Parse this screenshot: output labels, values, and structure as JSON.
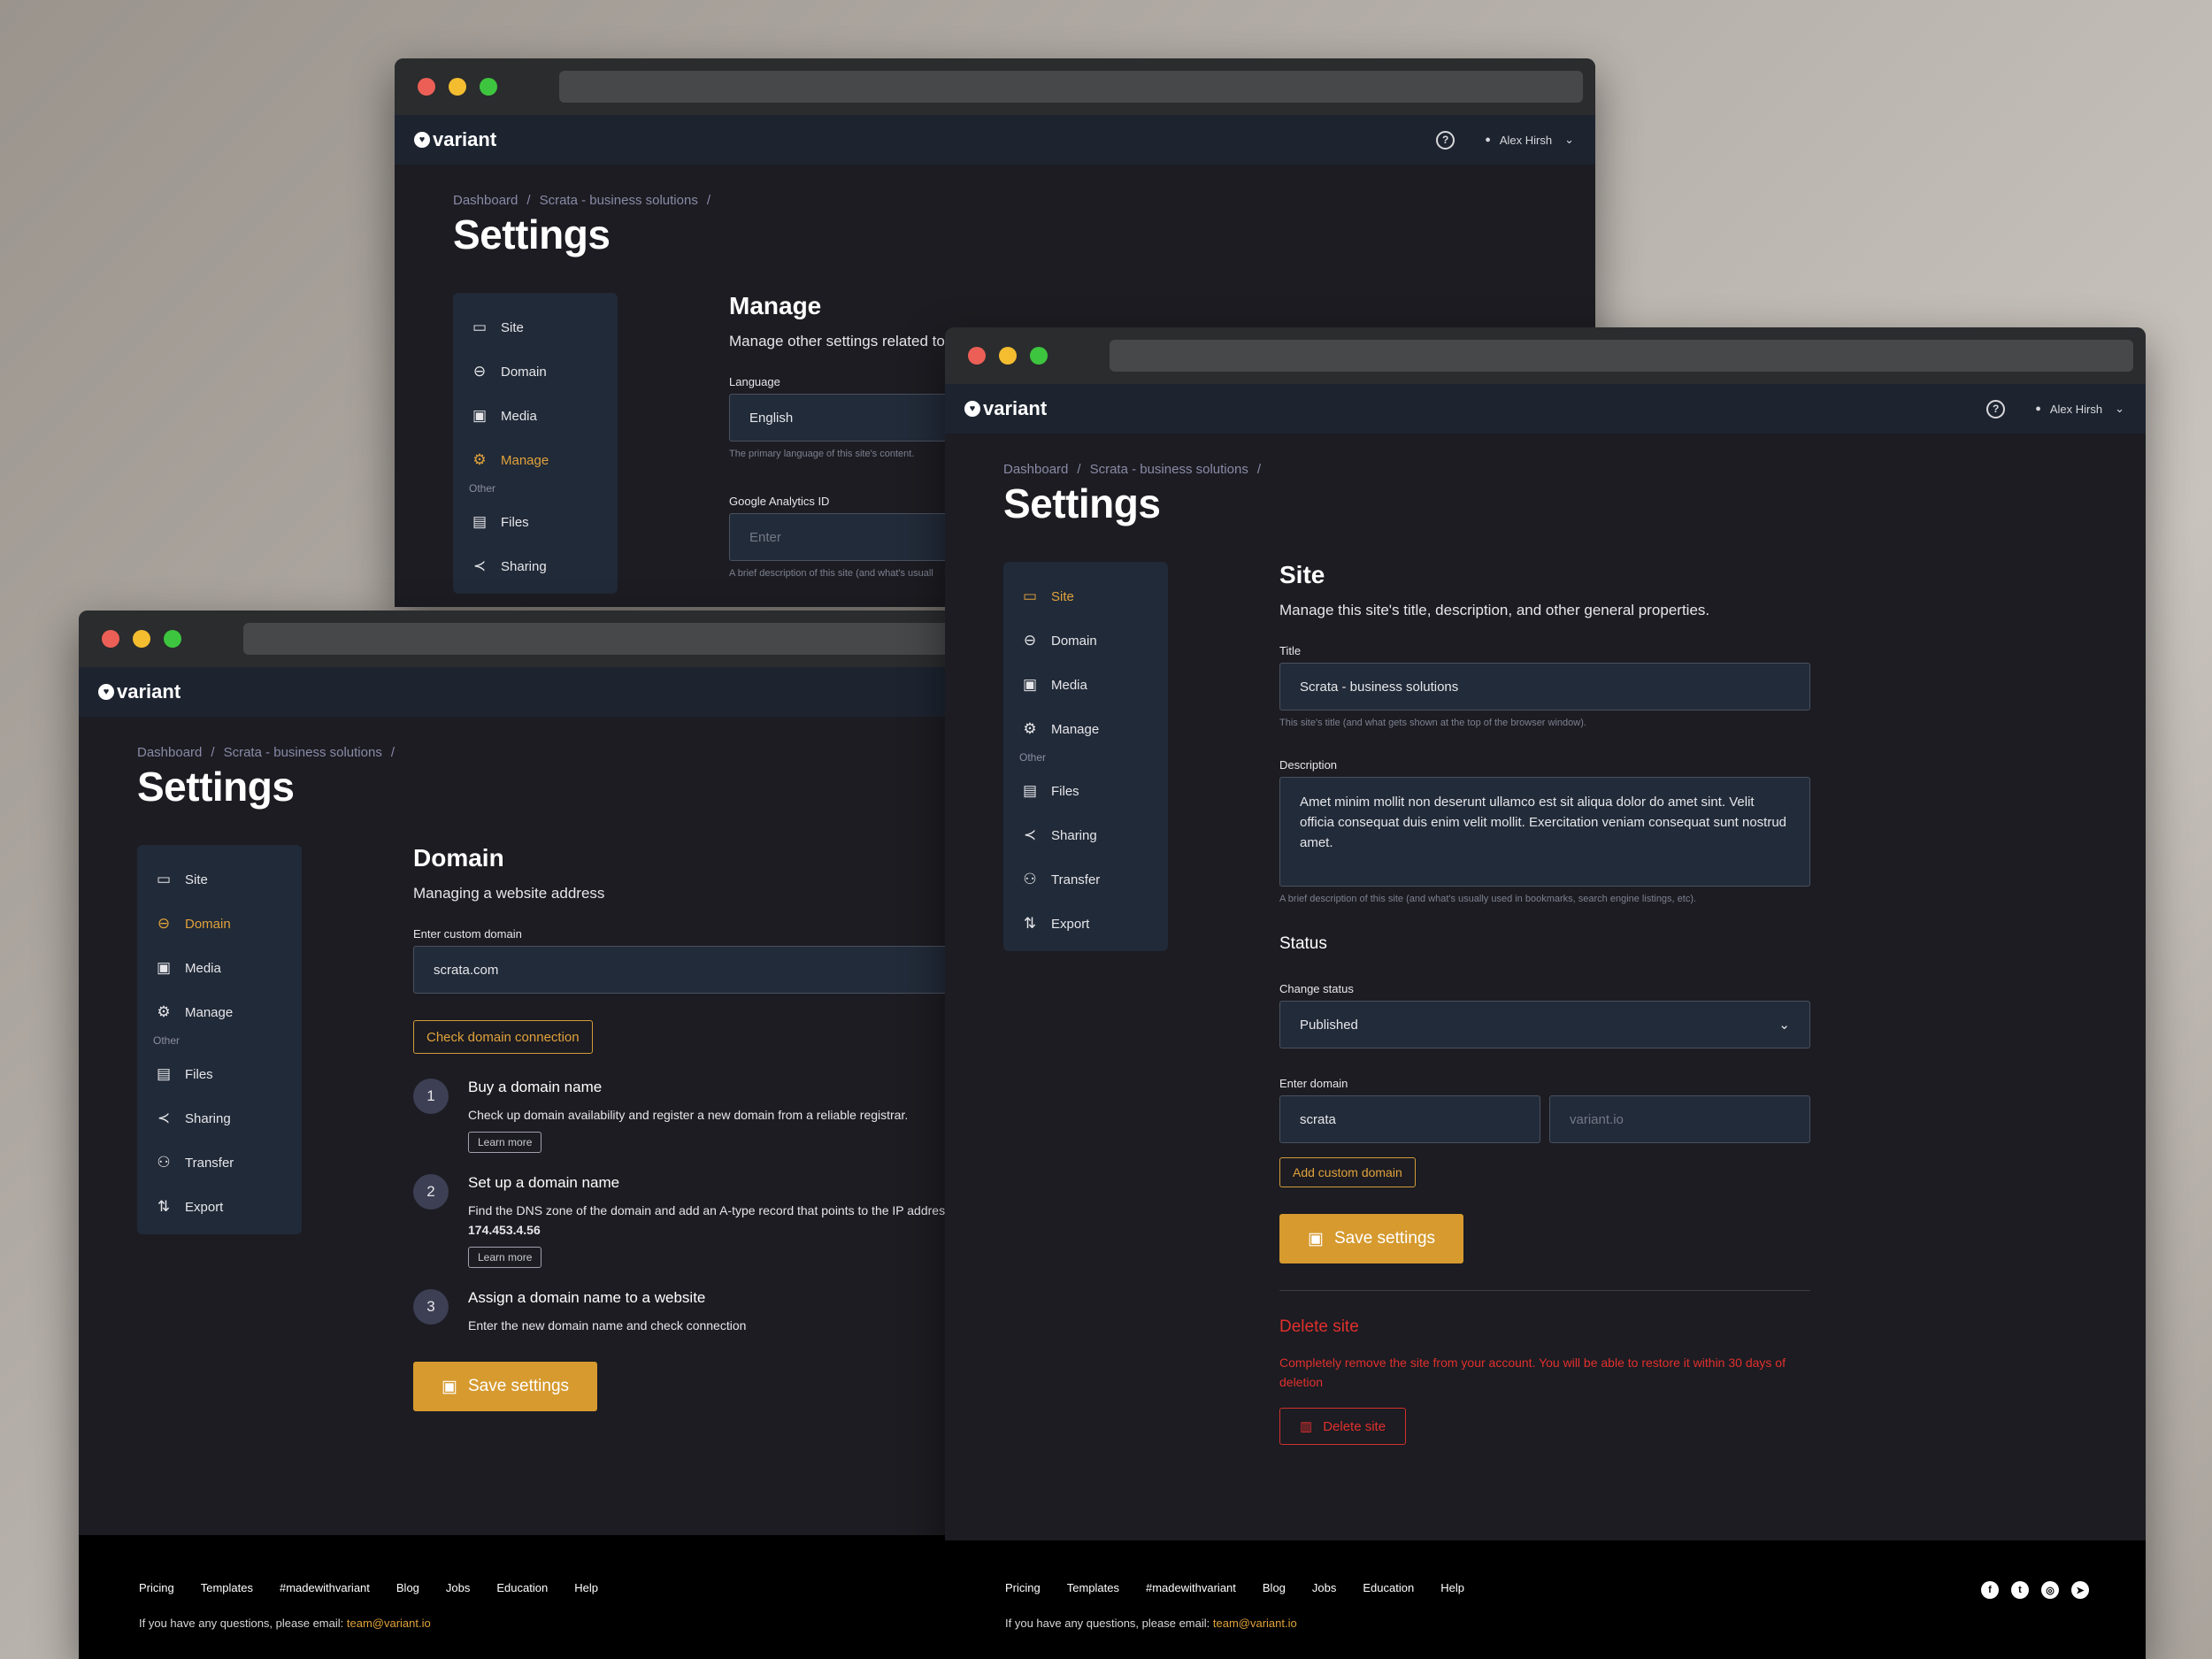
{
  "app": {
    "brand": "variant",
    "user_name": "Alex Hirsh",
    "page_title": "Settings",
    "breadcrumb": [
      "Dashboard",
      "Scrata - business solutions"
    ],
    "breadcrumb_sep": "/"
  },
  "nav": {
    "items": [
      "Site",
      "Domain",
      "Media",
      "Manage"
    ],
    "group_label": "Other",
    "other_items": [
      "Files",
      "Sharing",
      "Transfer",
      "Export"
    ]
  },
  "manage_window": {
    "title": "Manage",
    "description": "Manage other settings related to",
    "language_label": "Language",
    "language_value": "English",
    "language_hint": "The primary language of this site's content.",
    "ga_label": "Google Analytics ID",
    "ga_placeholder": "Enter",
    "ga_hint": "A brief description of this site (and what's usuall"
  },
  "domain_window": {
    "title": "Domain",
    "description": "Managing a website address",
    "custom_domain_label": "Enter custom domain",
    "custom_domain_value": "scrata.com",
    "check_button": "Check domain connection",
    "steps": [
      {
        "num": "1",
        "title": "Buy a domain name",
        "desc": "Check up domain availability and register a new domain from a reliable registrar.",
        "link": "Learn more"
      },
      {
        "num": "2",
        "title": "Set up a domain name",
        "desc": "Find the DNS zone of the domain and add an A-type record that points to the IP address",
        "ip": "174.453.4.56",
        "link": "Learn more"
      },
      {
        "num": "3",
        "title": "Assign a domain name to a website",
        "desc": "Enter the new domain name  and check connection"
      }
    ],
    "save_button": "Save settings"
  },
  "site_window": {
    "title": "Site",
    "description": "Manage this site's title, description, and other general properties.",
    "title_label": "Title",
    "title_value": "Scrata - business solutions",
    "title_hint": "This site's title (and what gets shown at the top of the browser window).",
    "description_label": "Description",
    "description_value": "Amet minim mollit non deserunt ullamco est sit aliqua dolor do amet sint. Velit officia consequat duis enim velit mollit. Exercitation veniam consequat sunt nostrud amet.",
    "description_hint": "A brief description of this site (and what's usually used in bookmarks, search engine listings, etc).",
    "status_heading": "Status",
    "status_label": "Change status",
    "status_value": "Published",
    "domain_label": "Enter domain",
    "domain_value": "scrata",
    "domain_suffix_placeholder": "variant.io",
    "add_domain_button": "Add custom domain",
    "save_button": "Save settings",
    "delete_title": "Delete site",
    "delete_desc": "Completely remove the site from your account. You will be able to restore it within 30 days of deletion",
    "delete_button": "Delete site"
  },
  "footer": {
    "links": [
      "Pricing",
      "Templates",
      "#madewithvariant",
      "Blog",
      "Jobs",
      "Education",
      "Help"
    ],
    "note": "If you have any questions, please email:",
    "email": "team@variant.io",
    "social": [
      "facebook-icon",
      "twitter-icon",
      "instagram-icon",
      "telegram-icon"
    ]
  },
  "colors": {
    "accent": "#d69a2f",
    "danger": "#e0302d",
    "panel": "#212a38",
    "background": "#1c1c22"
  }
}
